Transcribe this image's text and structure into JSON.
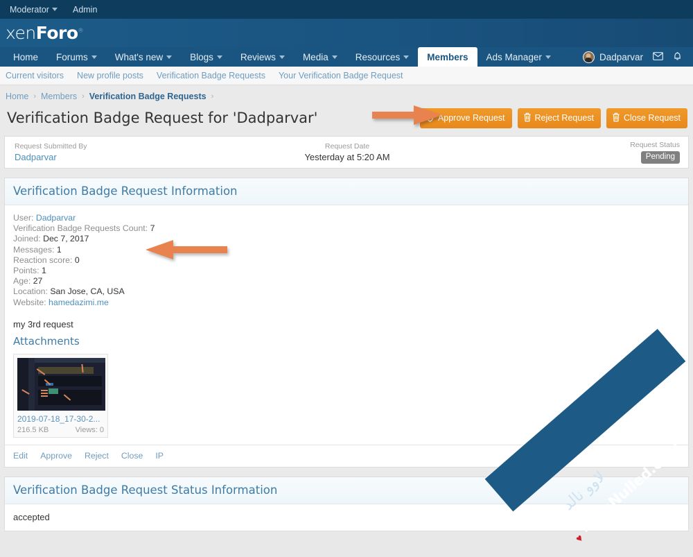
{
  "admin_bar": {
    "items": [
      {
        "label": "Moderator",
        "has_caret": true
      },
      {
        "label": "Admin",
        "has_caret": false
      }
    ]
  },
  "brand": {
    "logo_prefix": "xen",
    "logo_suffix": "Foro",
    "registered_mark": "®"
  },
  "nav": {
    "items": [
      {
        "label": "Home",
        "caret": false,
        "active": false
      },
      {
        "label": "Forums",
        "caret": true,
        "active": false
      },
      {
        "label": "What's new",
        "caret": true,
        "active": false
      },
      {
        "label": "Blogs",
        "caret": true,
        "active": false
      },
      {
        "label": "Reviews",
        "caret": true,
        "active": false
      },
      {
        "label": "Media",
        "caret": true,
        "active": false
      },
      {
        "label": "Resources",
        "caret": true,
        "active": false
      },
      {
        "label": "Members",
        "caret": false,
        "active": true
      },
      {
        "label": "Ads Manager",
        "caret": true,
        "active": false
      }
    ],
    "user": {
      "name": "Dadparvar",
      "avatar_icon": "user-avatar"
    },
    "icons": [
      {
        "name": "envelope-icon",
        "glyph": "✉"
      },
      {
        "name": "bell-icon",
        "glyph": "🔔"
      }
    ]
  },
  "subnav": {
    "items": [
      "Current visitors",
      "New profile posts",
      "Verification Badge Requests",
      "Your Verification Badge Request"
    ]
  },
  "breadcrumb": {
    "items": [
      "Home",
      "Members",
      "Verification Badge Requests"
    ],
    "separator": "›"
  },
  "page": {
    "title": "Verification Badge Request for 'Dadparvar'"
  },
  "actions": {
    "buttons": [
      {
        "label": "Approve Request",
        "icon": "shield-check-icon",
        "color": "#eb9223"
      },
      {
        "label": "Reject Request",
        "icon": "trash-icon",
        "color": "#eb9223"
      },
      {
        "label": "Close Request",
        "icon": "trash-icon",
        "color": "#eb9223"
      }
    ]
  },
  "info_strip": {
    "submitted_by": {
      "label": "Request Submitted By",
      "value": "Dadparvar"
    },
    "request_date": {
      "label": "Request Date",
      "value": "Yesterday at 5:20 AM"
    },
    "request_status": {
      "label": "Request Status",
      "value": "Pending",
      "badge_color": "#808080"
    }
  },
  "request_info": {
    "header": "Verification Badge Request Information",
    "fields": [
      {
        "key": "User:",
        "value": "Dadparvar",
        "is_link": true
      },
      {
        "key": "Verification Badge Requests Count:",
        "value": "7",
        "is_link": false
      },
      {
        "key": "Joined:",
        "value": "Dec 7, 2017",
        "is_link": false
      },
      {
        "key": "Messages:",
        "value": "1",
        "is_link": false
      },
      {
        "key": "Reaction score:",
        "value": "0",
        "is_link": false
      },
      {
        "key": "Points:",
        "value": "1",
        "is_link": false
      },
      {
        "key": "Age:",
        "value": "27",
        "is_link": false
      },
      {
        "key": "Location:",
        "value": "San Jose, CA, USA",
        "is_link": false
      },
      {
        "key": "Website:",
        "value": "hamedazimi.me",
        "is_link": true
      }
    ],
    "message": "my 3rd request",
    "attachments_title": "Attachments",
    "attachment": {
      "filename": "2019-07-18_17-30-2...",
      "size": "216.5 KB",
      "views": "Views: 0"
    },
    "footer_links": [
      "Edit",
      "Approve",
      "Reject",
      "Close",
      "IP"
    ]
  },
  "status_info": {
    "header": "Verification Badge Request Status Information",
    "value": "accepted"
  },
  "annotations": {
    "arrow_right_color": "#e8834f",
    "arrow_left_color": "#e8834f"
  },
  "watermark": {
    "text": "LoveNulled.com",
    "secondary_text": "لاوو نالد",
    "heart": "♥",
    "band_color": "#1d5b86"
  }
}
